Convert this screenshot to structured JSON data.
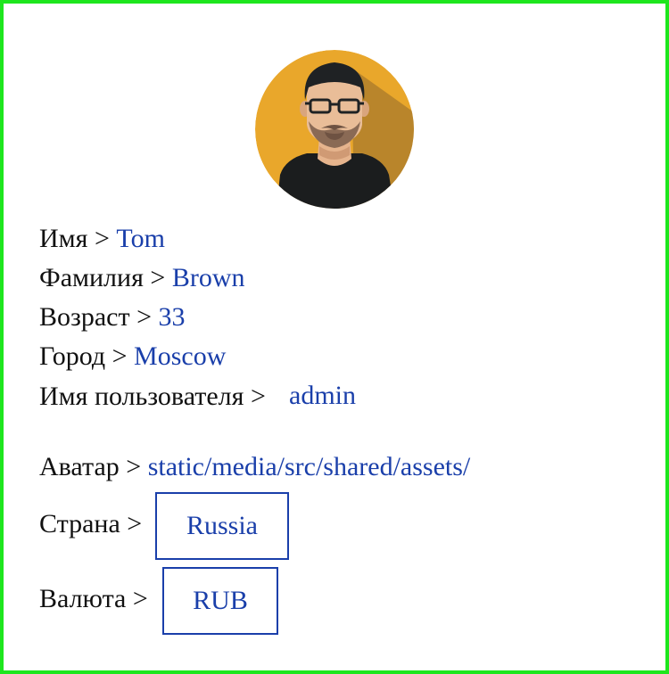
{
  "colors": {
    "frame": "#1ee61e",
    "label": "#111111",
    "value": "#1a3faa",
    "avatar_bg": "#e9a72b"
  },
  "avatar": {
    "icon": "user-avatar-icon"
  },
  "profile": {
    "first_name": {
      "label": "Имя >",
      "value": "Tom"
    },
    "last_name": {
      "label": "Фамилия >",
      "value": "Brown"
    },
    "age": {
      "label": "Возраст >",
      "value": "33"
    },
    "city": {
      "label": "Город >",
      "value": "Moscow"
    },
    "username": {
      "label": "Имя пользователя >",
      "value": "admin"
    },
    "avatar_path": {
      "label": "Аватар >",
      "value": "static/media/src/shared/assets/"
    },
    "country": {
      "label": "Страна >",
      "value": "Russia"
    },
    "currency": {
      "label": "Валюта >",
      "value": "RUB"
    }
  }
}
